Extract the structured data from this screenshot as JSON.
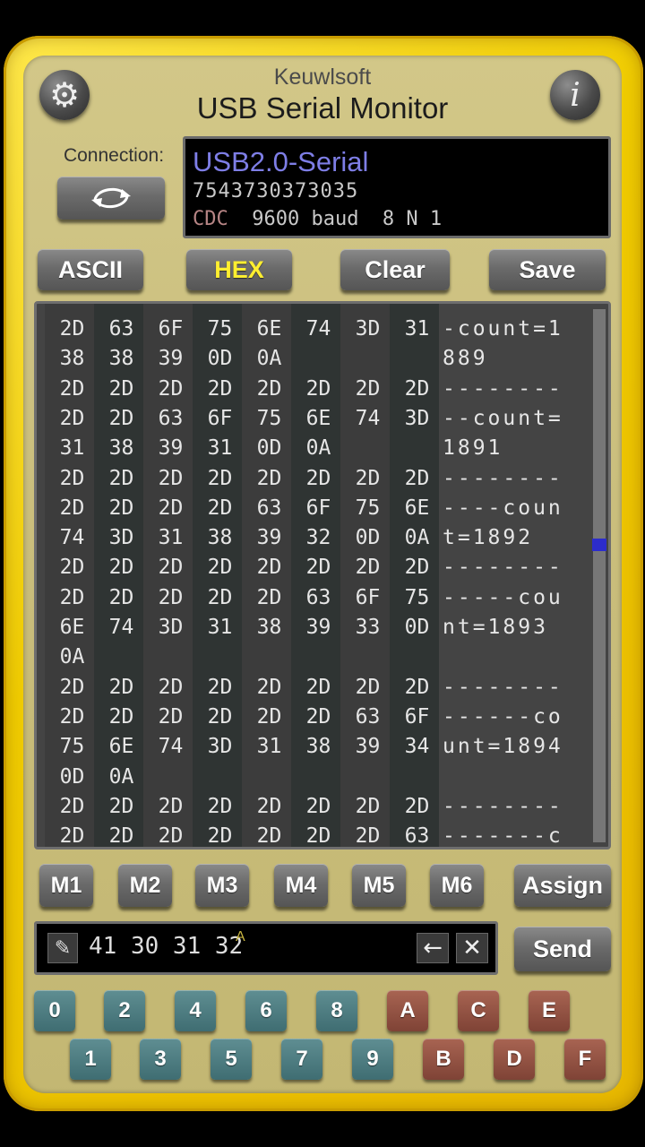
{
  "header": {
    "brand": "Keuwlsoft",
    "title": "USB Serial Monitor",
    "settings_icon": "gear-icon",
    "info_label": "i"
  },
  "connection": {
    "label": "Connection:",
    "button_icon": "refresh-icon",
    "device_name": "USB2.0-Serial",
    "device_serial": "7543730373035",
    "device_type": "CDC",
    "device_settings": "  9600 baud  8 N 1"
  },
  "toolbar": {
    "ascii_label": "ASCII",
    "hex_label": "HEX",
    "clear_label": "Clear",
    "save_label": "Save",
    "hex_active_color": "#ffef30"
  },
  "monitor": {
    "rows": [
      {
        "hex": [
          "2D",
          "63",
          "6F",
          "75",
          "6E",
          "74",
          "3D",
          "31"
        ],
        "ascii": "-count=1"
      },
      {
        "hex": [
          "38",
          "38",
          "39",
          "0D",
          "0A",
          "",
          "",
          ""
        ],
        "ascii": "889"
      },
      {
        "hex": [
          "2D",
          "2D",
          "2D",
          "2D",
          "2D",
          "2D",
          "2D",
          "2D"
        ],
        "ascii": "--------"
      },
      {
        "hex": [
          "2D",
          "2D",
          "63",
          "6F",
          "75",
          "6E",
          "74",
          "3D"
        ],
        "ascii": "--count="
      },
      {
        "hex": [
          "31",
          "38",
          "39",
          "31",
          "0D",
          "0A",
          "",
          ""
        ],
        "ascii": "1891"
      },
      {
        "hex": [
          "2D",
          "2D",
          "2D",
          "2D",
          "2D",
          "2D",
          "2D",
          "2D"
        ],
        "ascii": "--------"
      },
      {
        "hex": [
          "2D",
          "2D",
          "2D",
          "2D",
          "63",
          "6F",
          "75",
          "6E"
        ],
        "ascii": "----coun"
      },
      {
        "hex": [
          "74",
          "3D",
          "31",
          "38",
          "39",
          "32",
          "0D",
          "0A"
        ],
        "ascii": "t=1892"
      },
      {
        "hex": [
          "2D",
          "2D",
          "2D",
          "2D",
          "2D",
          "2D",
          "2D",
          "2D"
        ],
        "ascii": "--------"
      },
      {
        "hex": [
          "2D",
          "2D",
          "2D",
          "2D",
          "2D",
          "63",
          "6F",
          "75"
        ],
        "ascii": "-----cou"
      },
      {
        "hex": [
          "6E",
          "74",
          "3D",
          "31",
          "38",
          "39",
          "33",
          "0D"
        ],
        "ascii": "nt=1893"
      },
      {
        "hex": [
          "0A",
          "",
          "",
          "",
          "",
          "",
          "",
          ""
        ],
        "ascii": ""
      },
      {
        "hex": [
          "2D",
          "2D",
          "2D",
          "2D",
          "2D",
          "2D",
          "2D",
          "2D"
        ],
        "ascii": "--------"
      },
      {
        "hex": [
          "2D",
          "2D",
          "2D",
          "2D",
          "2D",
          "2D",
          "63",
          "6F"
        ],
        "ascii": "------co"
      },
      {
        "hex": [
          "75",
          "6E",
          "74",
          "3D",
          "31",
          "38",
          "39",
          "34"
        ],
        "ascii": "unt=1894"
      },
      {
        "hex": [
          "0D",
          "0A",
          "",
          "",
          "",
          "",
          "",
          ""
        ],
        "ascii": ""
      },
      {
        "hex": [
          "2D",
          "2D",
          "2D",
          "2D",
          "2D",
          "2D",
          "2D",
          "2D"
        ],
        "ascii": "--------"
      },
      {
        "hex": [
          "2D",
          "2D",
          "2D",
          "2D",
          "2D",
          "2D",
          "2D",
          "63"
        ],
        "ascii": "-------c"
      }
    ],
    "scroll_position": 0.43
  },
  "macros": [
    "M1",
    "M2",
    "M3",
    "M4",
    "M5",
    "M6"
  ],
  "assign_label": "Assign",
  "send_label": "Send",
  "input": {
    "edit_icon": "pencil-icon",
    "value": "41 30 31 32",
    "mode_mark": "A",
    "backspace_icon": "←",
    "clear_icon": "✕"
  },
  "keypad": {
    "top_row": [
      "0",
      "2",
      "4",
      "6",
      "8",
      "A",
      "C",
      "E"
    ],
    "bottom_row": [
      "1",
      "3",
      "5",
      "7",
      "9",
      "B",
      "D",
      "F"
    ]
  }
}
